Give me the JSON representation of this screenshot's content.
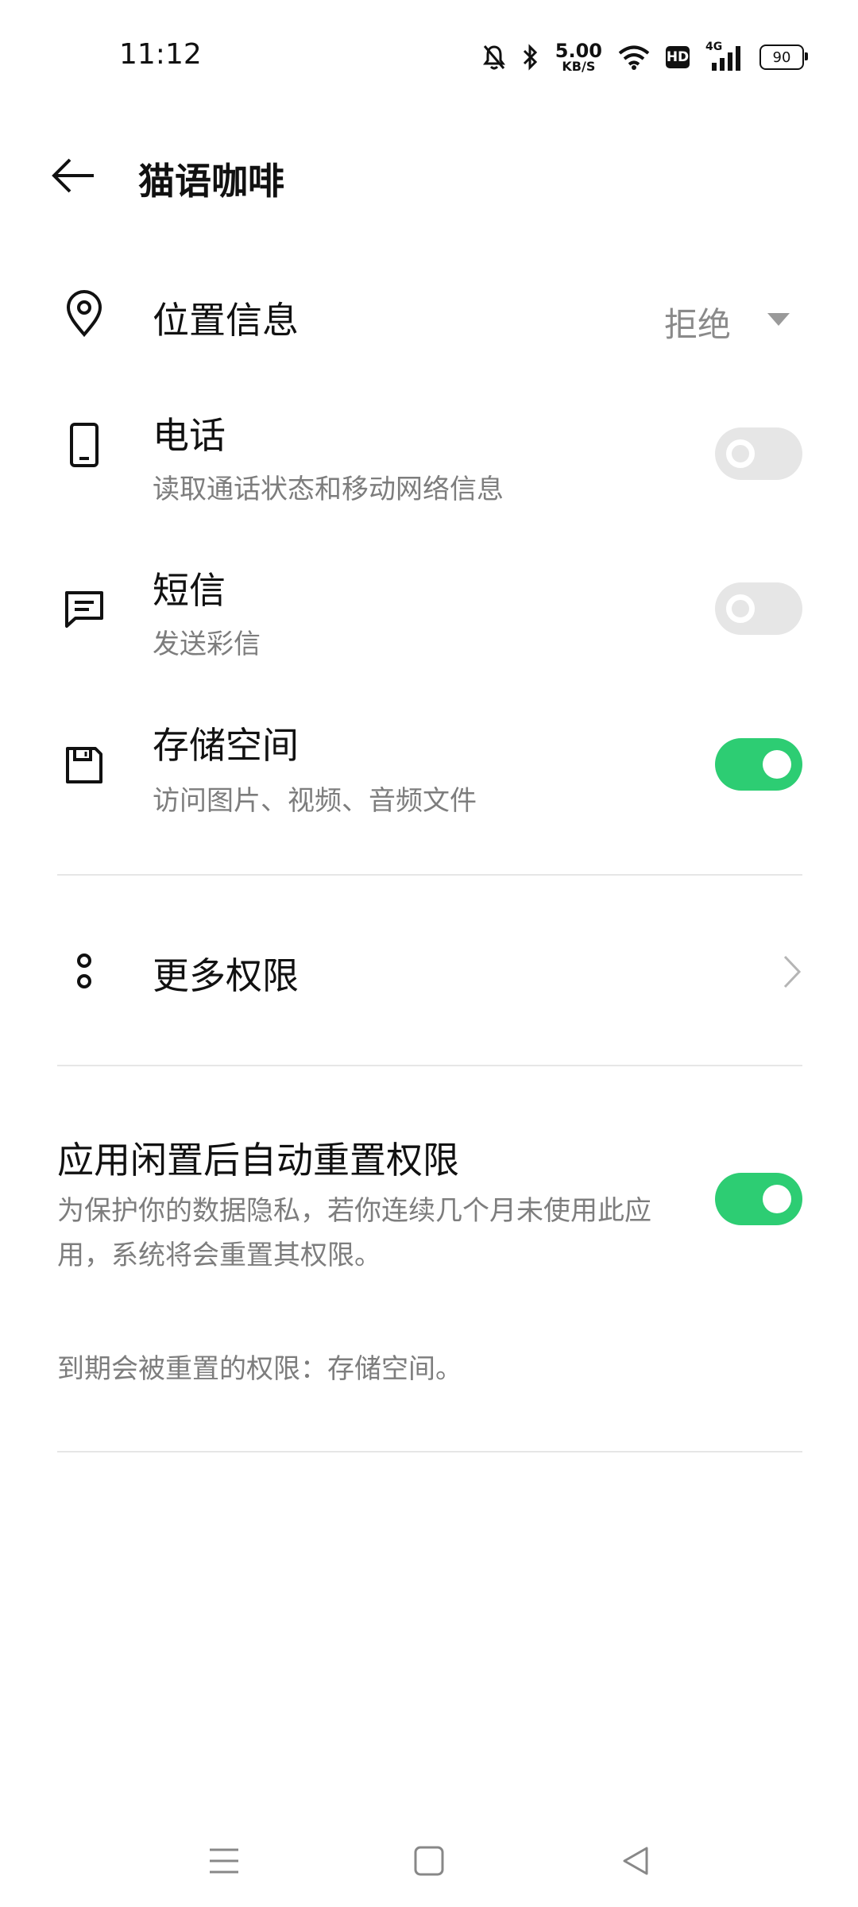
{
  "status_bar": {
    "time": "11:12",
    "speed_value": "5.00",
    "speed_unit": "KB/S",
    "hd_label": "HD",
    "network_label": "4G",
    "battery": "90"
  },
  "header": {
    "title": "猫语咖啡"
  },
  "permissions": [
    {
      "icon": "location-pin-icon",
      "title": "位置信息",
      "value": "拒绝"
    },
    {
      "icon": "phone-icon",
      "title": "电话",
      "subtitle": "读取通话状态和移动网络信息",
      "enabled": false
    },
    {
      "icon": "message-icon",
      "title": "短信",
      "subtitle": "发送彩信",
      "enabled": false
    },
    {
      "icon": "storage-icon",
      "title": "存储空间",
      "subtitle": "访问图片、视频、音频文件",
      "enabled": true
    }
  ],
  "more_permissions": {
    "title": "更多权限"
  },
  "auto_reset": {
    "title": "应用闲置后自动重置权限",
    "description": "为保护你的数据隐私，若你连续几个月未使用此应用，系统将会重置其权限。",
    "enabled": true,
    "note": "到期会被重置的权限：存储空间。"
  },
  "colors": {
    "accent": "#2dcd73",
    "toggle_off": "#e6e6e6",
    "secondary_text": "#7d7d7d"
  }
}
